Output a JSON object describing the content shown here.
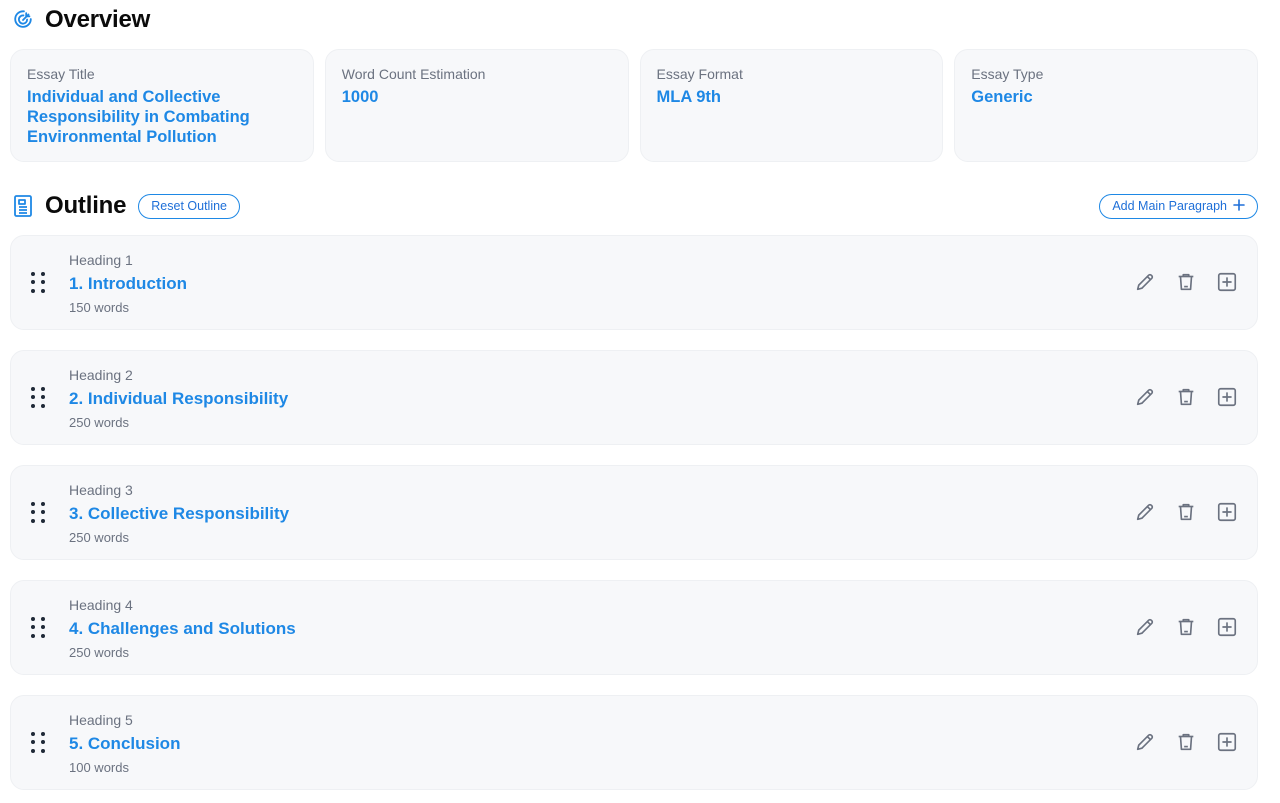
{
  "overview": {
    "title": "Overview",
    "cards": [
      {
        "label": "Essay Title",
        "value": "Individual and Collective Responsibility in Combating Environmental Pollution"
      },
      {
        "label": "Word Count Estimation",
        "value": "1000"
      },
      {
        "label": "Essay Format",
        "value": "MLA 9th"
      },
      {
        "label": "Essay Type",
        "value": "Generic"
      }
    ]
  },
  "outline": {
    "title": "Outline",
    "reset_label": "Reset Outline",
    "add_main_label": "Add Main Paragraph",
    "headings": [
      {
        "label": "Heading 1",
        "title": "1. Introduction",
        "words": "150 words"
      },
      {
        "label": "Heading 2",
        "title": "2. Individual Responsibility",
        "words": "250 words"
      },
      {
        "label": "Heading 3",
        "title": "3. Collective Responsibility",
        "words": "250 words"
      },
      {
        "label": "Heading 4",
        "title": "4. Challenges and Solutions",
        "words": "250 words"
      },
      {
        "label": "Heading 5",
        "title": "5. Conclusion",
        "words": "100 words"
      }
    ]
  },
  "icons": {
    "overview": "target-icon",
    "outline": "document-icon",
    "drag": "drag-handle-icon",
    "edit": "pencil-icon",
    "delete": "trash-icon",
    "add": "plus-square-icon",
    "add_main": "plus-icon"
  },
  "colors": {
    "accent": "#1e88e5",
    "card_bg": "#f7f8fa",
    "muted_text": "#6b7280",
    "icon_gray": "#6b7280"
  }
}
